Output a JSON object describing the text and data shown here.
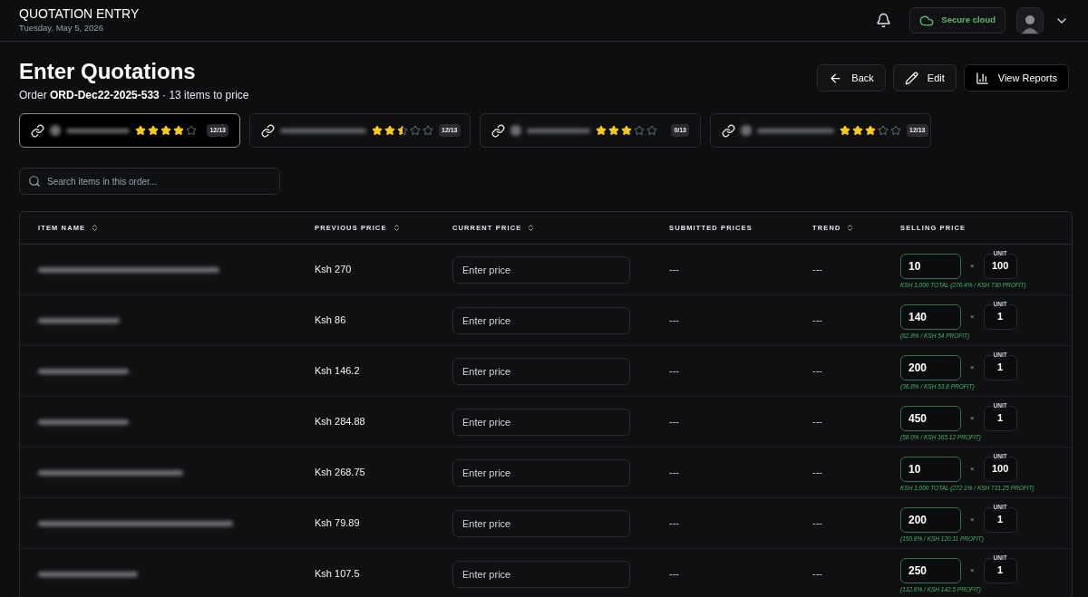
{
  "header": {
    "title": "QUOTATION ENTRY",
    "date": "Tuesday, May 5, 2026",
    "cloud_status": "Secure cloud"
  },
  "page": {
    "title": "Enter Quotations",
    "order_prefix": "Order",
    "order_id": "ORD-Dec22-2025-533",
    "order_suffix": "· 13 items to price"
  },
  "actions": [
    {
      "kind": "back",
      "label": "Back"
    },
    {
      "kind": "edit",
      "label": "Edit"
    },
    {
      "kind": "reports",
      "label": "View Reports"
    }
  ],
  "suppliers": [
    {
      "selected": true,
      "stars": 4,
      "count": "12/13",
      "logo": true
    },
    {
      "selected": false,
      "stars": 2.5,
      "count": "12/13",
      "logo": false
    },
    {
      "selected": false,
      "stars": 3,
      "count": "0/13",
      "logo": true
    },
    {
      "selected": false,
      "stars": 3,
      "count": "12/13",
      "logo": true
    }
  ],
  "search": {
    "placeholder": "Search items in this order..."
  },
  "table": {
    "columns": [
      {
        "label": "ITEM NAME",
        "sortable": true
      },
      {
        "label": "PREVIOUS PRICE",
        "sortable": true
      },
      {
        "label": "CURRENT PRICE",
        "sortable": true
      },
      {
        "label": "SUBMITTED PRICES",
        "sortable": false
      },
      {
        "label": "TREND",
        "sortable": true
      },
      {
        "label": "SELLING PRICE",
        "sortable": false
      }
    ],
    "rows": [
      {
        "previous_price": "Ksh 270",
        "price_placeholder": "Enter price",
        "submitted": "---",
        "trend": "---",
        "selling": "10",
        "times": "×",
        "unit_label": "UNIT",
        "unit": "100",
        "profit": "KSH 1,000 TOTAL (270.4% / KSH 730 PROFIT)"
      },
      {
        "previous_price": "Ksh 86",
        "price_placeholder": "Enter price",
        "submitted": "---",
        "trend": "---",
        "selling": "140",
        "times": "×",
        "unit_label": "UNIT",
        "unit": "1",
        "profit": "(62.8% / KSH 54 PROFIT)"
      },
      {
        "previous_price": "Ksh 146.2",
        "price_placeholder": "Enter price",
        "submitted": "---",
        "trend": "---",
        "selling": "200",
        "times": "×",
        "unit_label": "UNIT",
        "unit": "1",
        "profit": "(36.8% / KSH 53.8 PROFIT)"
      },
      {
        "previous_price": "Ksh 284.88",
        "price_placeholder": "Enter price",
        "submitted": "---",
        "trend": "---",
        "selling": "450",
        "times": "×",
        "unit_label": "UNIT",
        "unit": "1",
        "profit": "(58.0% / KSH 165.12 PROFIT)"
      },
      {
        "previous_price": "Ksh 268.75",
        "price_placeholder": "Enter price",
        "submitted": "---",
        "trend": "---",
        "selling": "10",
        "times": "×",
        "unit_label": "UNIT",
        "unit": "100",
        "profit": "KSH 1,000 TOTAL (272.1% / KSH 731.25 PROFIT)"
      },
      {
        "previous_price": "Ksh 79.89",
        "price_placeholder": "Enter price",
        "submitted": "---",
        "trend": "---",
        "selling": "200",
        "times": "×",
        "unit_label": "UNIT",
        "unit": "1",
        "profit": "(150.8% / KSH 120.11 PROFIT)"
      },
      {
        "previous_price": "Ksh 107.5",
        "price_placeholder": "Enter price",
        "submitted": "---",
        "trend": "---",
        "selling": "250",
        "times": "×",
        "unit_label": "UNIT",
        "unit": "1",
        "profit": "(132.6% / KSH 142.5 PROFIT)"
      }
    ]
  }
}
